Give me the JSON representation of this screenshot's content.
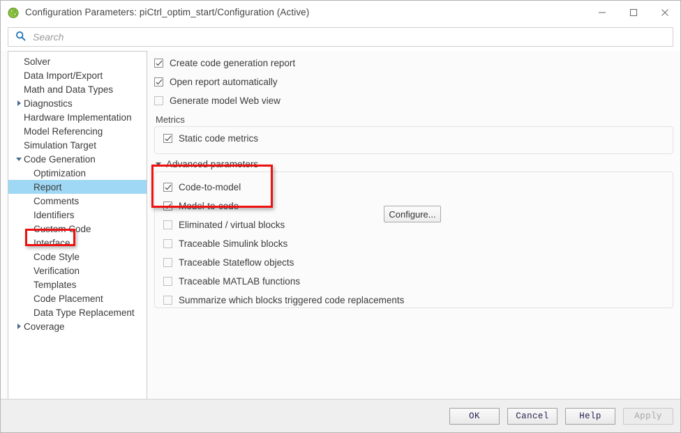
{
  "window": {
    "title": "Configuration Parameters: piCtrl_optim_start/Configuration (Active)",
    "app_icon": "simulink-icon",
    "minimize_label": "Minimize",
    "maximize_label": "Maximize",
    "close_label": "Close"
  },
  "search": {
    "icon": "search-icon",
    "placeholder": "Search",
    "value": ""
  },
  "tree": {
    "items": [
      {
        "label": "Solver",
        "level": 0,
        "twisty": "none",
        "selected": false
      },
      {
        "label": "Data Import/Export",
        "level": 0,
        "twisty": "none",
        "selected": false
      },
      {
        "label": "Math and Data Types",
        "level": 0,
        "twisty": "none",
        "selected": false
      },
      {
        "label": "Diagnostics",
        "level": 0,
        "twisty": "right",
        "selected": false
      },
      {
        "label": "Hardware Implementation",
        "level": 0,
        "twisty": "none",
        "selected": false
      },
      {
        "label": "Model Referencing",
        "level": 0,
        "twisty": "none",
        "selected": false
      },
      {
        "label": "Simulation Target",
        "level": 0,
        "twisty": "none",
        "selected": false
      },
      {
        "label": "Code Generation",
        "level": 0,
        "twisty": "down",
        "selected": false
      },
      {
        "label": "Optimization",
        "level": 1,
        "twisty": "none",
        "selected": false
      },
      {
        "label": "Report",
        "level": 1,
        "twisty": "none",
        "selected": true
      },
      {
        "label": "Comments",
        "level": 1,
        "twisty": "none",
        "selected": false
      },
      {
        "label": "Identifiers",
        "level": 1,
        "twisty": "none",
        "selected": false
      },
      {
        "label": "Custom Code",
        "level": 1,
        "twisty": "none",
        "selected": false
      },
      {
        "label": "Interface",
        "level": 1,
        "twisty": "none",
        "selected": false
      },
      {
        "label": "Code Style",
        "level": 1,
        "twisty": "none",
        "selected": false
      },
      {
        "label": "Verification",
        "level": 1,
        "twisty": "none",
        "selected": false
      },
      {
        "label": "Templates",
        "level": 1,
        "twisty": "none",
        "selected": false
      },
      {
        "label": "Code Placement",
        "level": 1,
        "twisty": "none",
        "selected": false
      },
      {
        "label": "Data Type Replacement",
        "level": 1,
        "twisty": "none",
        "selected": false
      },
      {
        "label": "Coverage",
        "level": 0,
        "twisty": "right",
        "selected": false
      }
    ]
  },
  "panel": {
    "top_options": [
      {
        "label": "Create code generation report",
        "checked": true
      },
      {
        "label": "Open report automatically",
        "checked": true
      },
      {
        "label": "Generate model Web view",
        "checked": false
      }
    ],
    "metrics": {
      "group_label": "Metrics",
      "options": [
        {
          "label": "Static code metrics",
          "checked": true
        }
      ]
    },
    "advanced": {
      "section_label": "Advanced parameters",
      "expanded": true,
      "configure_button": "Configure...",
      "options": [
        {
          "label": "Code-to-model",
          "checked": true
        },
        {
          "label": "Model-to-code",
          "checked": true
        },
        {
          "label": "Eliminated / virtual blocks",
          "checked": false
        },
        {
          "label": "Traceable Simulink blocks",
          "checked": false
        },
        {
          "label": "Traceable Stateflow objects",
          "checked": false
        },
        {
          "label": "Traceable MATLAB functions",
          "checked": false
        },
        {
          "label": "Summarize which blocks triggered code replacements",
          "checked": false
        }
      ]
    }
  },
  "annotations": {
    "highlight_color": "#ee1111",
    "boxes": [
      {
        "target": "Report"
      },
      {
        "target": "Metrics"
      }
    ]
  },
  "footer": {
    "buttons": [
      {
        "label": "OK",
        "disabled": false
      },
      {
        "label": "Cancel",
        "disabled": false
      },
      {
        "label": "Help",
        "disabled": false
      },
      {
        "label": "Apply",
        "disabled": true
      }
    ]
  }
}
